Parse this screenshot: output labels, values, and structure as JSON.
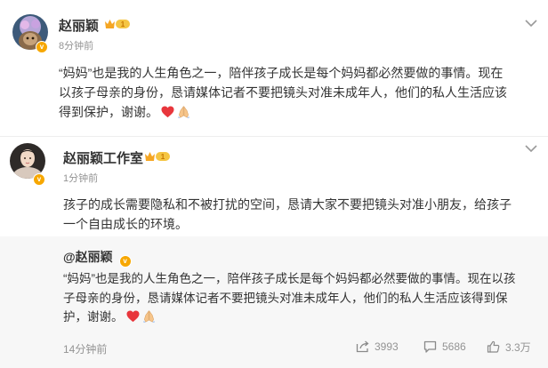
{
  "post1": {
    "author": "赵丽颖",
    "verified_badge": "v",
    "rank_badge": "1",
    "time": "8分钟前",
    "lines": [
      "“妈妈”也是我的人生角色之一，陪伴孩子成长是每个妈妈都必然要做的事情。现在",
      "以孩子母亲的身份，恳请媒体记者不要把镜头对准未成年人，他们的私人生活应该",
      "得到保护，谢谢。"
    ],
    "emojis": [
      "red-heart-icon",
      "folded-hands-icon"
    ]
  },
  "post2": {
    "author": "赵丽颖工作室",
    "verified_badge": "v",
    "rank_badge": "1",
    "time": "1分钟前",
    "lines": [
      "孩子的成长需要隐私和不被打扰的空间，恳请大家不要把镜头对准小朋友，给孩子",
      "一个自由成长的环境。"
    ]
  },
  "repost": {
    "mention": "@赵丽颖",
    "verified_badge": "v",
    "lines": [
      "“妈妈”也是我的人生角色之一，陪伴孩子成长是每个妈妈都必然要做的事情。现在以孩",
      "子母亲的身份，恳请媒体记者不要把镜头对准未成年人，他们的私人生活应该得到保",
      "护，谢谢。"
    ],
    "emojis": [
      "red-heart-icon",
      "folded-hands-icon"
    ],
    "time": "14分钟前",
    "reposts": "3993",
    "comments": "5686",
    "likes": "3.3万"
  },
  "colors": {
    "badge_orange": "#f7a700",
    "heart_red": "#e8363c",
    "muted": "#939393",
    "repost_bg": "#f7f7f7"
  }
}
